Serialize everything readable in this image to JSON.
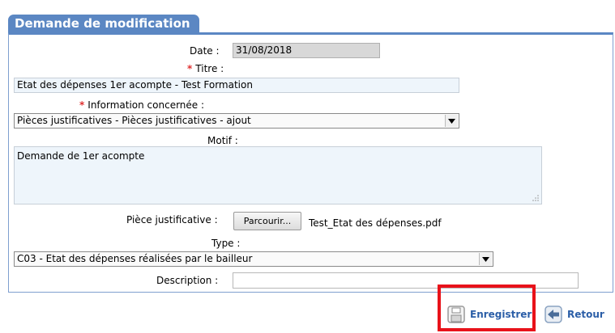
{
  "panel": {
    "title": "Demande de modification"
  },
  "form": {
    "date_label": "Date :",
    "date_value": "31/08/2018",
    "required_mark": "*",
    "titre_label": "Titre :",
    "titre_value": "Etat des dépenses 1er acompte - Test Formation",
    "info_label": "Information concernée :",
    "info_value": "Pièces justificatives - Pièces justificatives - ajout",
    "motif_label": "Motif :",
    "motif_value": "Demande de 1er acompte",
    "piece_label": "Pièce justificative :",
    "browse_label": "Parcourir...",
    "file_name": "Test_Etat des dépenses.pdf",
    "type_label": "Type :",
    "type_value": "C03 - Etat des dépenses réalisées par le bailleur",
    "description_label": "Description :",
    "description_value": ""
  },
  "actions": {
    "save_label": "Enregistrer",
    "back_label": "Retour"
  },
  "colors": {
    "header": "#5b87c3",
    "highlight": "#e8121a",
    "link": "#2b5ea7"
  }
}
